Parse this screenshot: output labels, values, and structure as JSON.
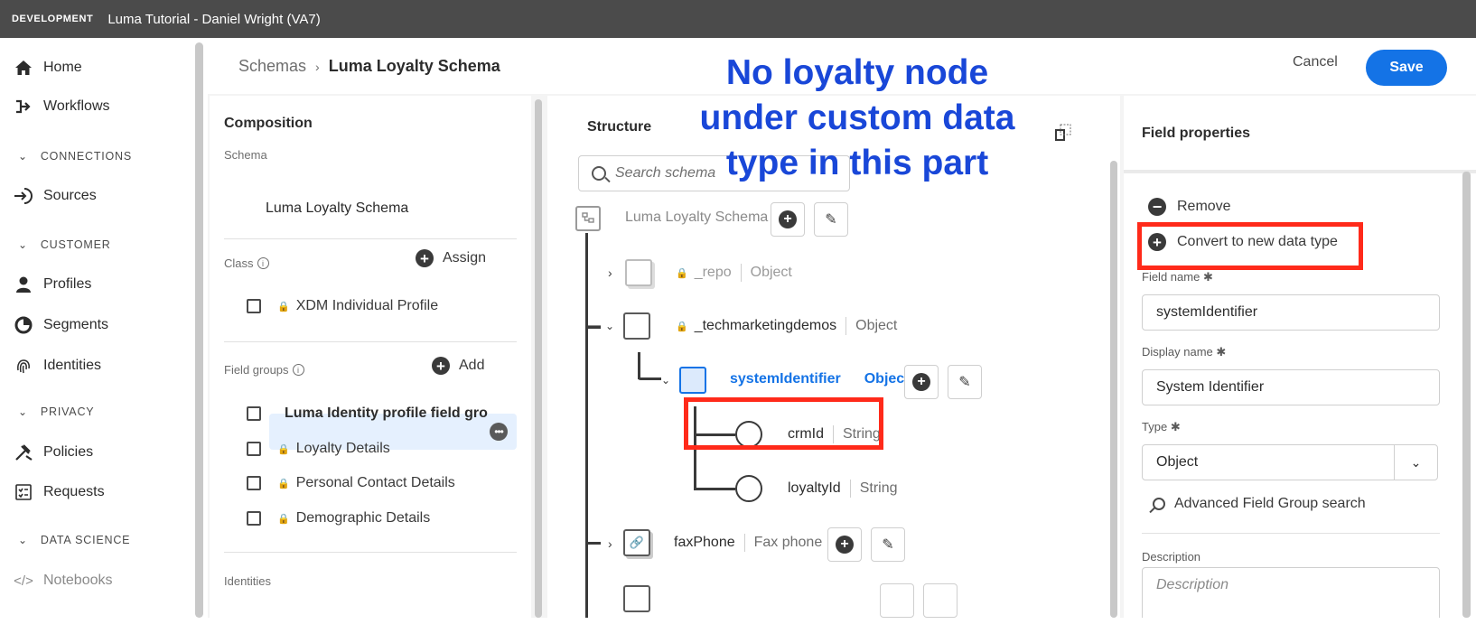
{
  "topbar": {
    "environment": "DEVELOPMENT",
    "org": "Luma Tutorial - Daniel Wright (VA7)"
  },
  "nav": {
    "items": [
      {
        "label": "Home",
        "icon": "home-icon"
      },
      {
        "label": "Workflows",
        "icon": "workflows-icon"
      },
      {
        "label": "Sources",
        "icon": "sources-icon"
      },
      {
        "label": "Profiles",
        "icon": "profiles-icon"
      },
      {
        "label": "Segments",
        "icon": "segments-icon"
      },
      {
        "label": "Identities",
        "icon": "fingerprint-icon"
      },
      {
        "label": "Policies",
        "icon": "policies-icon"
      },
      {
        "label": "Requests",
        "icon": "requests-icon"
      },
      {
        "label": "Notebooks",
        "icon": "code-icon"
      }
    ],
    "sections": [
      "CONNECTIONS",
      "CUSTOMER",
      "PRIVACY",
      "DATA SCIENCE"
    ]
  },
  "breadcrumb": {
    "parent": "Schemas",
    "current": "Luma Loyalty Schema"
  },
  "header": {
    "cancel_label": "Cancel",
    "save_label": "Save"
  },
  "composition": {
    "title": "Composition",
    "schema_label": "Schema",
    "schema_name": "Luma Loyalty Schema",
    "class_label": "Class",
    "assign_label": "Assign",
    "class_item": "XDM Individual Profile",
    "field_groups_label": "Field groups",
    "add_label": "Add",
    "field_groups": [
      "Luma Identity profile field gro",
      "Loyalty Details",
      "Personal Contact Details",
      "Demographic Details"
    ],
    "identities_label": "Identities"
  },
  "structure": {
    "title": "Structure",
    "search_placeholder": "Search schema",
    "root": "Luma Loyalty Schema",
    "nodes": {
      "repo": {
        "name": "_repo",
        "type": "Object"
      },
      "tech": {
        "name": "_techmarketingdemos",
        "type": "Object"
      },
      "sysid": {
        "name": "systemIdentifier",
        "type": "Object"
      },
      "crm": {
        "name": "crmId",
        "type": "String"
      },
      "loyalty": {
        "name": "loyaltyId",
        "type": "String"
      },
      "fax": {
        "name": "faxPhone",
        "type": "Fax phone"
      }
    }
  },
  "props": {
    "title": "Field properties",
    "remove_label": "Remove",
    "convert_label": "Convert to new data type",
    "field_name_label": "Field name",
    "field_name_value": "systemIdentifier",
    "display_name_label": "Display name",
    "display_name_value": "System Identifier",
    "type_label": "Type",
    "type_value": "Object",
    "advanced_search_label": "Advanced Field Group search",
    "description_label": "Description",
    "description_placeholder": "Description"
  },
  "annotation": {
    "line1": "No loyalty node",
    "line2": "under custom data",
    "line3": "type in this part",
    "highlight_color": "#ff2a1a",
    "text_color": "#1947d8"
  },
  "colors": {
    "accent": "#1473e6",
    "topbar": "#4b4b4b",
    "selection": "#e5f0fe"
  }
}
